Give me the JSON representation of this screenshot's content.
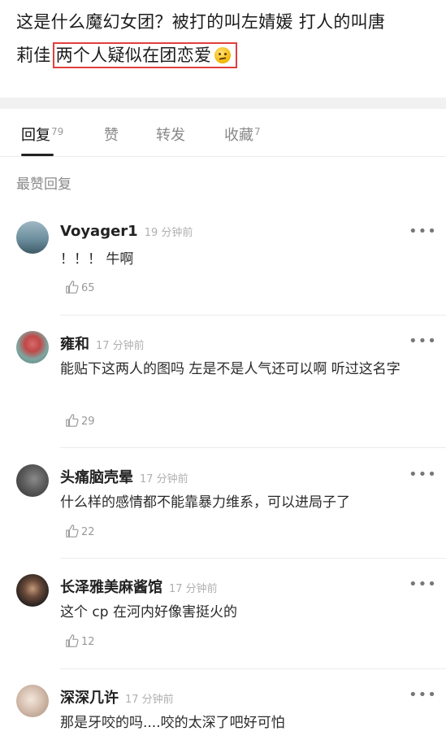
{
  "post": {
    "line1": "这是什么魔幻女团？被打的叫左婧媛 打人的叫唐",
    "line2_prefix": "莉佳",
    "line2_highlight": "两个人疑似在团恋爱",
    "emoji": "thinking-face"
  },
  "tabs": [
    {
      "label": "回复",
      "count": "79",
      "active": true
    },
    {
      "label": "赞",
      "count": "",
      "active": false
    },
    {
      "label": "转发",
      "count": "",
      "active": false
    },
    {
      "label": "收藏",
      "count": "7",
      "active": false
    }
  ],
  "section_title": "最赞回复",
  "more_icon": "•••",
  "comments": [
    {
      "name": "Voyager1",
      "time": "19 分钟前",
      "text": "！！！ 牛啊",
      "likes": "65"
    },
    {
      "name": "雍和",
      "time": "17 分钟前",
      "text": "能贴下这两人的图吗 左是不是人气还可以啊 听过这名字",
      "likes": "29"
    },
    {
      "name": "头痛脑壳晕",
      "time": "17 分钟前",
      "text": "什么样的感情都不能靠暴力维系，可以进局子了",
      "likes": "22"
    },
    {
      "name": "长泽雅美麻酱馆",
      "time": "17 分钟前",
      "text": "这个 cp 在河内好像害挺火的",
      "likes": "12"
    },
    {
      "name": "深深几许",
      "time": "17 分钟前",
      "text": "那是牙咬的吗....咬的太深了吧好可怕",
      "likes": ""
    }
  ],
  "colors": {
    "highlight_border": "#e0403d",
    "tab_active": "#111111",
    "muted": "#999999"
  }
}
